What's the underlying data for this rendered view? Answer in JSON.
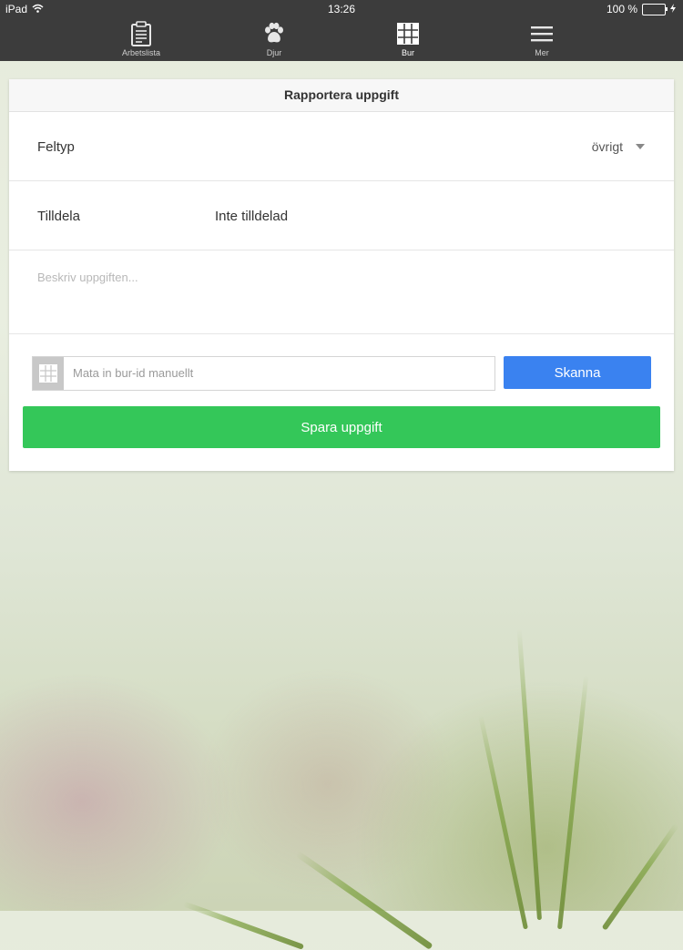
{
  "status_bar": {
    "device": "iPad",
    "time": "13:26",
    "battery": "100 %",
    "battery_level": 1.0
  },
  "tabs": [
    {
      "label": "Arbetslista",
      "icon": "clipboard-icon",
      "active": false
    },
    {
      "label": "Djur",
      "icon": "paw-icon",
      "active": false
    },
    {
      "label": "Bur",
      "icon": "cage-grid-icon",
      "active": true
    },
    {
      "label": "Mer",
      "icon": "hamburger-menu-icon",
      "active": false
    }
  ],
  "form": {
    "title": "Rapportera uppgift",
    "feltyp_label": "Feltyp",
    "feltyp_value": "övrigt",
    "tilldela_label": "Tilldela",
    "tilldela_value": "Inte tilldelad",
    "description_placeholder": "Beskriv uppgiften...",
    "cage_id_placeholder": "Mata in bur-id manuellt",
    "scan_label": "Skanna",
    "save_label": "Spara uppgift"
  },
  "colors": {
    "bar_bg": "#3c3c3c",
    "scan_button": "#3a82f0",
    "save_button": "#34c759",
    "battery": "#4cd964"
  }
}
